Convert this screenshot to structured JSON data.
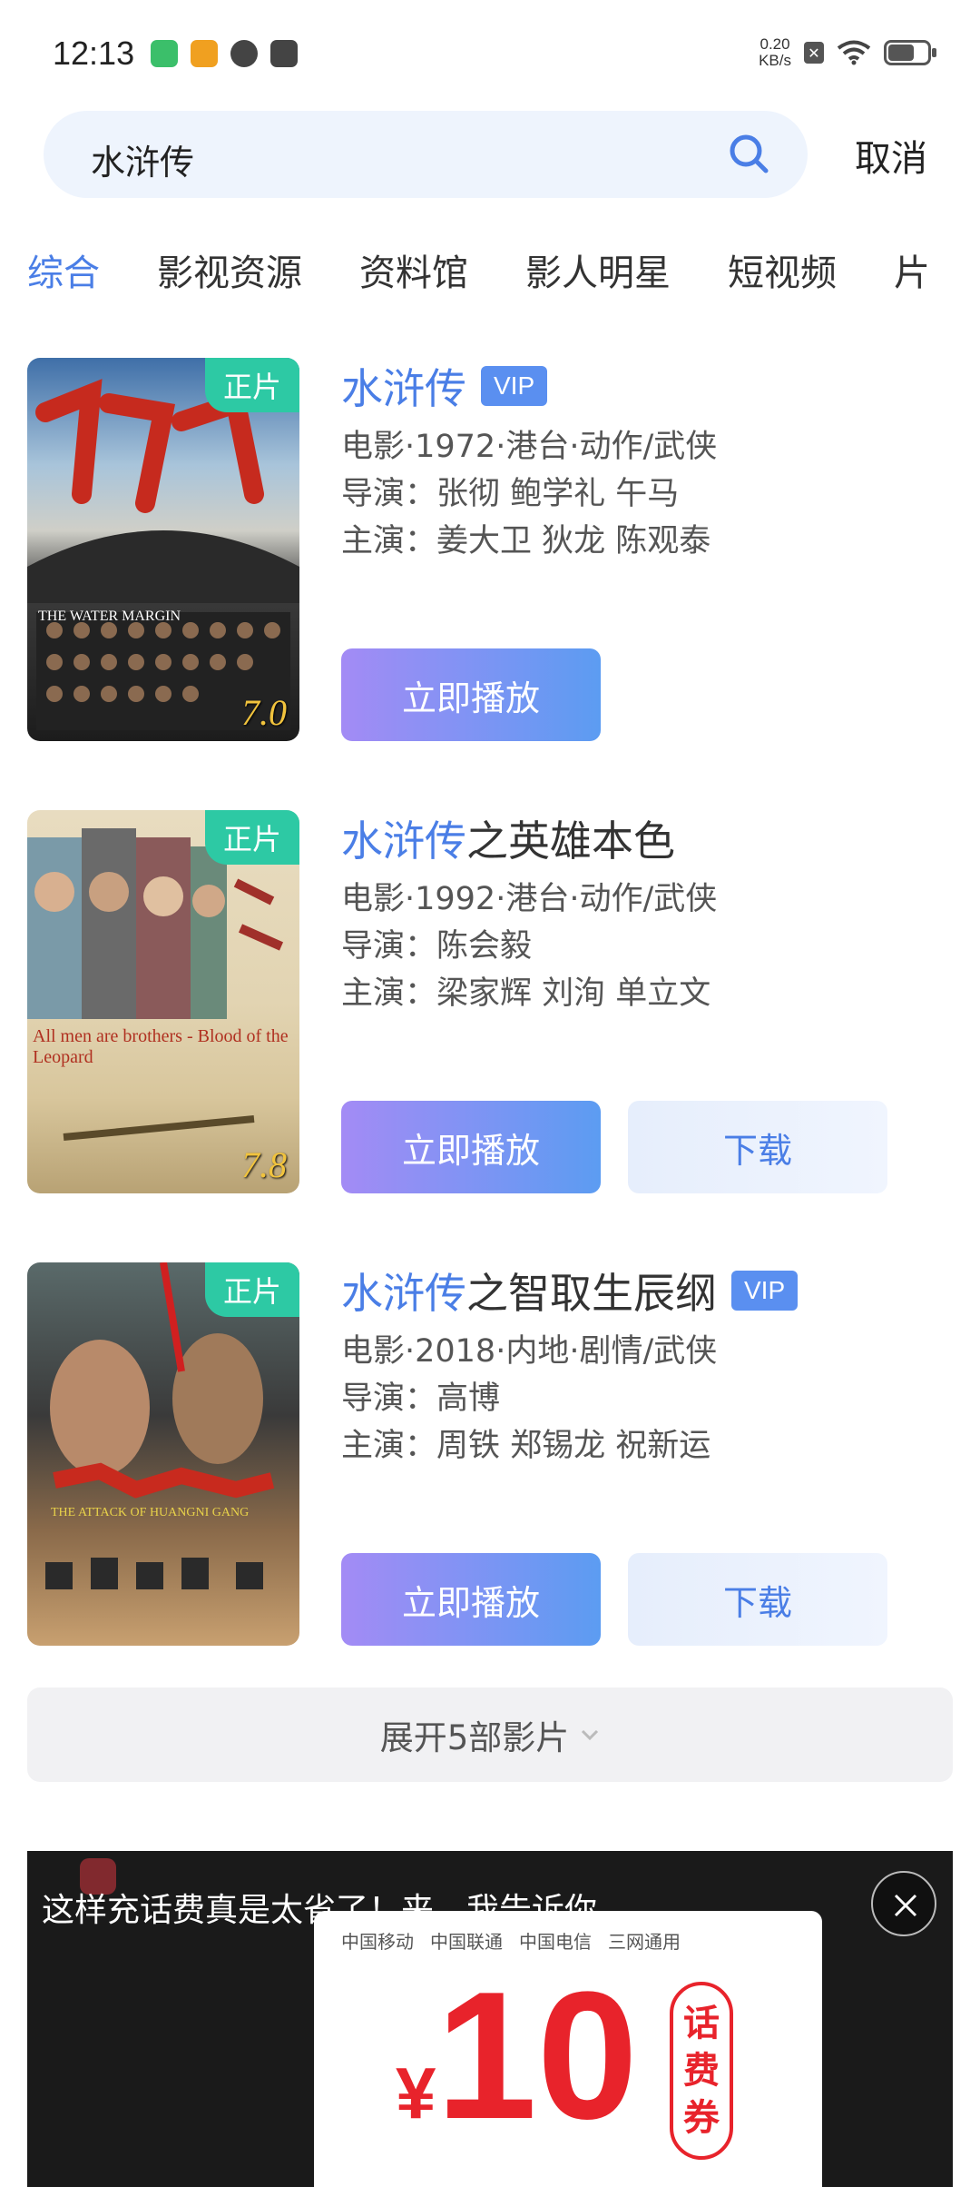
{
  "status_bar": {
    "time": "12:13",
    "net_speed_value": "0.20",
    "net_speed_unit": "KB/s",
    "app_icons": [
      "app-icon-green",
      "app-icon-1905",
      "app-icon-leaf",
      "app-icon-message"
    ]
  },
  "search": {
    "query": "水浒传",
    "cancel_label": "取消"
  },
  "tabs": [
    {
      "label": "综合",
      "active": true
    },
    {
      "label": "影视资源",
      "active": false
    },
    {
      "label": "资料馆",
      "active": false
    },
    {
      "label": "影人明星",
      "active": false
    },
    {
      "label": "短视频",
      "active": false
    },
    {
      "label": "片",
      "active": false
    }
  ],
  "results": [
    {
      "title_highlight": "水浒传",
      "title_rest": "",
      "vip": "VIP",
      "tag": "正片",
      "rating": "7.0",
      "meta": "电影·1972·港台·动作/武侠",
      "director": "导演：张彻 鲍学礼 午马",
      "cast": "主演：姜大卫 狄龙 陈观泰",
      "play_label": "立即播放",
      "download_label": "",
      "poster_en": "THE WATER MARGIN"
    },
    {
      "title_highlight": "水浒传",
      "title_rest": "之英雄本色",
      "vip": "",
      "tag": "正片",
      "rating": "7.8",
      "meta": "电影·1992·港台·动作/武侠",
      "director": "导演：陈会毅",
      "cast": "主演：梁家辉 刘洵 单立文",
      "play_label": "立即播放",
      "download_label": "下载",
      "poster_en": "All men are brothers - Blood of the Leopard"
    },
    {
      "title_highlight": "水浒传",
      "title_rest": "之智取生辰纲",
      "vip": "VIP",
      "tag": "正片",
      "rating": "",
      "meta": "电影·2018·内地·剧情/武侠",
      "director": "导演：高博",
      "cast": "主演：周铁 郑锡龙 祝新运",
      "play_label": "立即播放",
      "download_label": "下载",
      "poster_en": "THE ATTACK OF HUANGNI GANG"
    }
  ],
  "expand": {
    "label": "展开5部影片"
  },
  "ad": {
    "text": "这样充话费真是太省了！来，我告诉你",
    "carriers": [
      "中国移动",
      "中国联通",
      "中国电信",
      "三网通用"
    ],
    "yen": "¥",
    "amount": "10",
    "voucher": [
      "话",
      "费",
      "券"
    ]
  },
  "colors": {
    "accent": "#4a7ee6",
    "tag_green": "#2dc9a4",
    "vip_blue": "#5a8ff0",
    "ad_red": "#e8232b"
  }
}
